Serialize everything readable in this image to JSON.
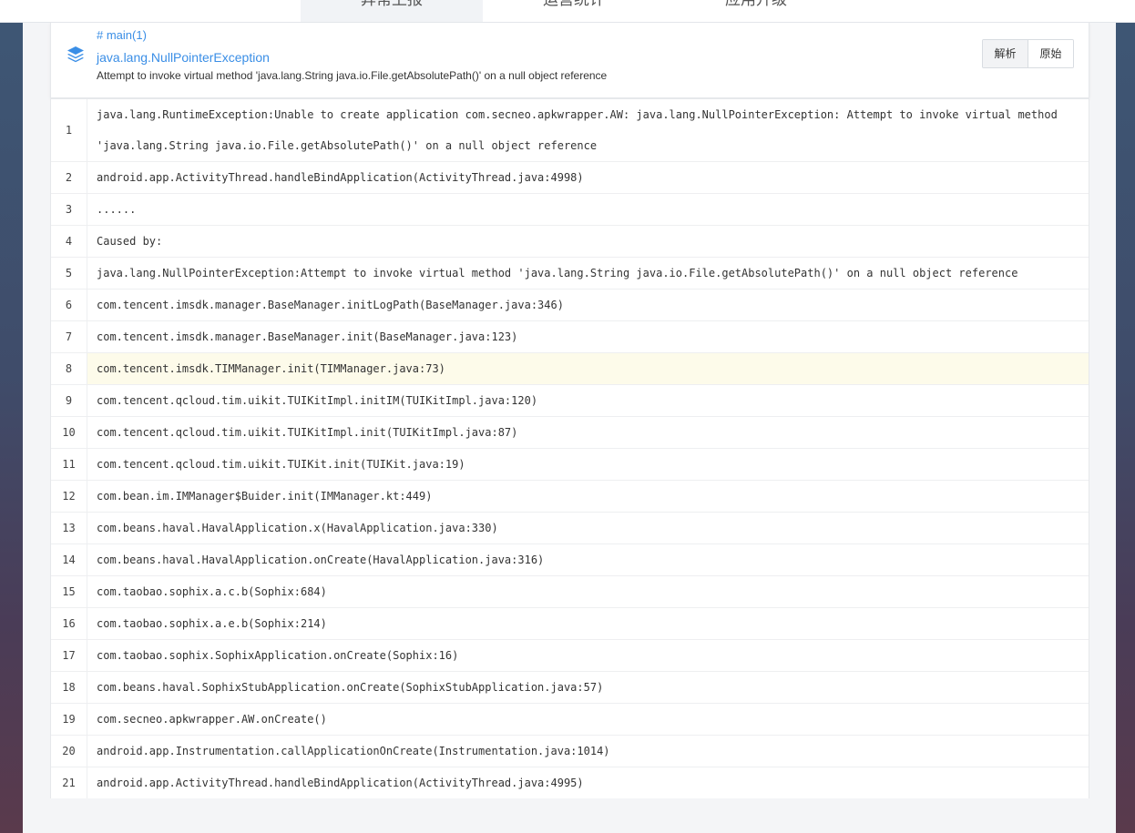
{
  "tabs": [
    {
      "label": "异常上报",
      "active": true
    },
    {
      "label": "运营统计",
      "active": false
    },
    {
      "label": "应用升级",
      "active": false
    }
  ],
  "header": {
    "icon": "layers-icon",
    "thread": "# main(1)",
    "exception_type": "java.lang.NullPointerException",
    "message": "Attempt to invoke virtual method 'java.lang.String java.io.File.getAbsolutePath()' on a null object reference",
    "buttons": {
      "parse": "解析",
      "raw": "原始"
    }
  },
  "colors": {
    "link": "#3a8ee6",
    "highlight_row": "#fdfbea"
  },
  "highlighted_line": 8,
  "stack": [
    {
      "n": "1",
      "text": "java.lang.RuntimeException:Unable to create application com.secneo.apkwrapper.AW: java.lang.NullPointerException: Attempt to invoke virtual method 'java.lang.String java.io.File.getAbsolutePath()' on a null object reference"
    },
    {
      "n": "2",
      "text": "android.app.ActivityThread.handleBindApplication(ActivityThread.java:4998)"
    },
    {
      "n": "3",
      "text": "......"
    },
    {
      "n": "4",
      "text": "Caused by:"
    },
    {
      "n": "5",
      "text": "java.lang.NullPointerException:Attempt to invoke virtual method 'java.lang.String java.io.File.getAbsolutePath()' on a null object reference"
    },
    {
      "n": "6",
      "text": "com.tencent.imsdk.manager.BaseManager.initLogPath(BaseManager.java:346)"
    },
    {
      "n": "7",
      "text": "com.tencent.imsdk.manager.BaseManager.init(BaseManager.java:123)"
    },
    {
      "n": "8",
      "text": "com.tencent.imsdk.TIMManager.init(TIMManager.java:73)"
    },
    {
      "n": "9",
      "text": "com.tencent.qcloud.tim.uikit.TUIKitImpl.initIM(TUIKitImpl.java:120)"
    },
    {
      "n": "10",
      "text": "com.tencent.qcloud.tim.uikit.TUIKitImpl.init(TUIKitImpl.java:87)"
    },
    {
      "n": "11",
      "text": "com.tencent.qcloud.tim.uikit.TUIKit.init(TUIKit.java:19)"
    },
    {
      "n": "12",
      "text": "com.bean.im.IMManager$Buider.init(IMManager.kt:449)"
    },
    {
      "n": "13",
      "text": "com.beans.haval.HavalApplication.x(HavalApplication.java:330)"
    },
    {
      "n": "14",
      "text": "com.beans.haval.HavalApplication.onCreate(HavalApplication.java:316)"
    },
    {
      "n": "15",
      "text": "com.taobao.sophix.a.c.b(Sophix:684)"
    },
    {
      "n": "16",
      "text": "com.taobao.sophix.a.e.b(Sophix:214)"
    },
    {
      "n": "17",
      "text": "com.taobao.sophix.SophixApplication.onCreate(Sophix:16)"
    },
    {
      "n": "18",
      "text": "com.beans.haval.SophixStubApplication.onCreate(SophixStubApplication.java:57)"
    },
    {
      "n": "19",
      "text": "com.secneo.apkwrapper.AW.onCreate()"
    },
    {
      "n": "20",
      "text": "android.app.Instrumentation.callApplicationOnCreate(Instrumentation.java:1014)"
    },
    {
      "n": "21",
      "text": "android.app.ActivityThread.handleBindApplication(ActivityThread.java:4995)"
    }
  ]
}
